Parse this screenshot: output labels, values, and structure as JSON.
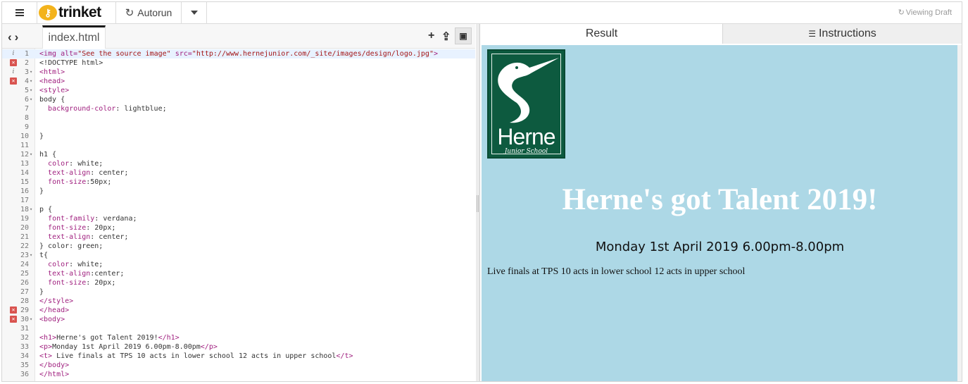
{
  "topbar": {
    "brand": "trinket",
    "autorun_label": "Autorun",
    "viewing_draft": "Viewing Draft"
  },
  "editor": {
    "file_tab": "index.html",
    "lines": [
      {
        "n": "1",
        "marker": "info",
        "fold": false,
        "active": true,
        "html": "<span class=\"tag\">&lt;img</span> <span class=\"attr\">alt=</span><span class=\"str\">\"See the source image\"</span> <span class=\"attr\">src=</span><span class=\"str\">\"http://www.hernejunior.com/_site/images/design/logo.jpg\"</span><span class=\"tag\">&gt;</span>"
      },
      {
        "n": "2",
        "marker": "err",
        "fold": false,
        "active": false,
        "html": "&lt;!DOCTYPE html&gt;"
      },
      {
        "n": "3",
        "marker": "info",
        "fold": true,
        "active": false,
        "html": "<span class=\"tag\">&lt;html&gt;</span>"
      },
      {
        "n": "4",
        "marker": "err",
        "fold": true,
        "active": false,
        "html": "<span class=\"tag\">&lt;head&gt;</span>"
      },
      {
        "n": "5",
        "marker": "",
        "fold": true,
        "active": false,
        "html": "<span class=\"tag\">&lt;style&gt;</span>"
      },
      {
        "n": "6",
        "marker": "",
        "fold": true,
        "active": false,
        "html": "body {"
      },
      {
        "n": "7",
        "marker": "",
        "fold": false,
        "active": false,
        "html": "  <span class=\"prop\">background-color</span>: lightblue;"
      },
      {
        "n": "8",
        "marker": "",
        "fold": false,
        "active": false,
        "html": ""
      },
      {
        "n": "9",
        "marker": "",
        "fold": false,
        "active": false,
        "html": ""
      },
      {
        "n": "10",
        "marker": "",
        "fold": false,
        "active": false,
        "html": "}"
      },
      {
        "n": "11",
        "marker": "",
        "fold": false,
        "active": false,
        "html": ""
      },
      {
        "n": "12",
        "marker": "",
        "fold": true,
        "active": false,
        "html": "h1 {"
      },
      {
        "n": "13",
        "marker": "",
        "fold": false,
        "active": false,
        "html": "  <span class=\"prop\">color</span>: white;"
      },
      {
        "n": "14",
        "marker": "",
        "fold": false,
        "active": false,
        "html": "  <span class=\"prop\">text-align</span>: center;"
      },
      {
        "n": "15",
        "marker": "",
        "fold": false,
        "active": false,
        "html": "  <span class=\"prop\">font-size</span>:50px;"
      },
      {
        "n": "16",
        "marker": "",
        "fold": false,
        "active": false,
        "html": "}"
      },
      {
        "n": "17",
        "marker": "",
        "fold": false,
        "active": false,
        "html": ""
      },
      {
        "n": "18",
        "marker": "",
        "fold": true,
        "active": false,
        "html": "p {"
      },
      {
        "n": "19",
        "marker": "",
        "fold": false,
        "active": false,
        "html": "  <span class=\"prop\">font-family</span>: verdana;"
      },
      {
        "n": "20",
        "marker": "",
        "fold": false,
        "active": false,
        "html": "  <span class=\"prop\">font-size</span>: 20px;"
      },
      {
        "n": "21",
        "marker": "",
        "fold": false,
        "active": false,
        "html": "  <span class=\"prop\">text-align</span>: center;"
      },
      {
        "n": "22",
        "marker": "",
        "fold": false,
        "active": false,
        "html": "} color: green;"
      },
      {
        "n": "23",
        "marker": "",
        "fold": true,
        "active": false,
        "html": "t{"
      },
      {
        "n": "24",
        "marker": "",
        "fold": false,
        "active": false,
        "html": "  <span class=\"prop\">color</span>: white;"
      },
      {
        "n": "25",
        "marker": "",
        "fold": false,
        "active": false,
        "html": "  <span class=\"prop\">text-align</span>:center;"
      },
      {
        "n": "26",
        "marker": "",
        "fold": false,
        "active": false,
        "html": "  <span class=\"prop\">font-size</span>: 20px;"
      },
      {
        "n": "27",
        "marker": "",
        "fold": false,
        "active": false,
        "html": "}"
      },
      {
        "n": "28",
        "marker": "",
        "fold": false,
        "active": false,
        "html": "<span class=\"tag\">&lt;/style&gt;</span>"
      },
      {
        "n": "29",
        "marker": "err",
        "fold": false,
        "active": false,
        "html": "<span class=\"tag\">&lt;/head&gt;</span>"
      },
      {
        "n": "30",
        "marker": "err",
        "fold": true,
        "active": false,
        "html": "<span class=\"tag\">&lt;body&gt;</span>"
      },
      {
        "n": "31",
        "marker": "",
        "fold": false,
        "active": false,
        "html": ""
      },
      {
        "n": "32",
        "marker": "",
        "fold": false,
        "active": false,
        "html": "<span class=\"tag\">&lt;h1&gt;</span>Herne's got Talent 2019!<span class=\"tag\">&lt;/h1&gt;</span>"
      },
      {
        "n": "33",
        "marker": "",
        "fold": false,
        "active": false,
        "html": "<span class=\"tag\">&lt;p&gt;</span>Monday 1st April 2019 6.00pm-8.00pm<span class=\"tag\">&lt;/p&gt;</span>"
      },
      {
        "n": "34",
        "marker": "",
        "fold": false,
        "active": false,
        "html": "<span class=\"tag\">&lt;t&gt;</span> Live finals at TPS 10 acts in lower school 12 acts in upper school<span class=\"tag\">&lt;/t&gt;</span>"
      },
      {
        "n": "35",
        "marker": "",
        "fold": false,
        "active": false,
        "html": "<span class=\"tag\">&lt;/body&gt;</span>"
      },
      {
        "n": "36",
        "marker": "",
        "fold": false,
        "active": false,
        "html": "<span class=\"tag\">&lt;/html&gt;</span>"
      }
    ]
  },
  "result_tabs": {
    "result": "Result",
    "instructions": "Instructions"
  },
  "result": {
    "logo_name": "Herne",
    "logo_sub": "Junior School",
    "h1": "Herne's got Talent 2019!",
    "p": "Monday 1st April 2019 6.00pm-8.00pm",
    "t": "Live finals at TPS 10 acts in lower school 12 acts in upper school",
    "background": "#add8e6"
  },
  "colors": {
    "logo_green": "#0d5a3f",
    "error_marker": "#d9534f",
    "tag": "#a0207f",
    "string": "#a31515"
  }
}
